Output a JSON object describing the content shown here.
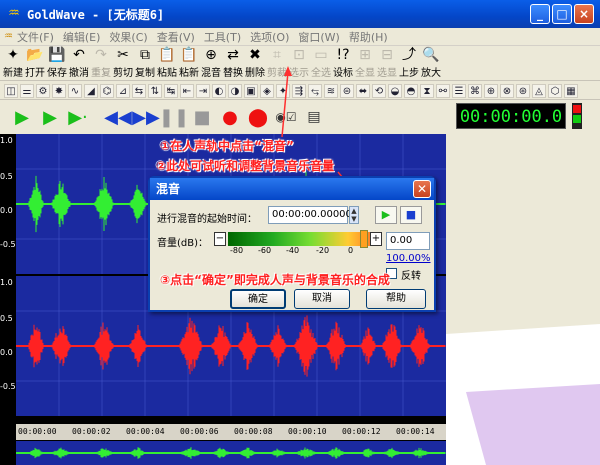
{
  "window": {
    "title": "GoldWave - [无标题6]",
    "controls": [
      "_",
      "□",
      "×"
    ]
  },
  "menu": [
    "文件(F)",
    "编辑(E)",
    "效果(C)",
    "查看(V)",
    "工具(T)",
    "选项(O)",
    "窗口(W)",
    "帮助(H)"
  ],
  "toolbar": [
    {
      "label": "新建",
      "icon": "✦",
      "enabled": true
    },
    {
      "label": "打开",
      "icon": "📂",
      "enabled": true
    },
    {
      "label": "保存",
      "icon": "💾",
      "enabled": true
    },
    {
      "label": "撤消",
      "icon": "↶",
      "enabled": true
    },
    {
      "label": "重复",
      "icon": "↷",
      "enabled": false
    },
    {
      "label": "剪切",
      "icon": "✂",
      "enabled": true
    },
    {
      "label": "复制",
      "icon": "⧉",
      "enabled": true
    },
    {
      "label": "粘贴",
      "icon": "📋",
      "enabled": true
    },
    {
      "label": "粘新",
      "icon": "📋",
      "enabled": true
    },
    {
      "label": "混音",
      "icon": "⊕",
      "enabled": true
    },
    {
      "label": "替换",
      "icon": "⇄",
      "enabled": true
    },
    {
      "label": "删除",
      "icon": "✖",
      "enabled": true
    },
    {
      "label": "剪裁",
      "icon": "⌗",
      "enabled": false
    },
    {
      "label": "选示",
      "icon": "⊡",
      "enabled": false
    },
    {
      "label": "全选",
      "icon": "▭",
      "enabled": false
    },
    {
      "label": "设标",
      "icon": "!?",
      "enabled": true
    },
    {
      "label": "全显",
      "icon": "⊞",
      "enabled": false
    },
    {
      "label": "选显",
      "icon": "⊟",
      "enabled": false
    },
    {
      "label": "上步",
      "icon": "⤴",
      "enabled": true
    },
    {
      "label": "放大",
      "icon": "🔍",
      "enabled": true
    }
  ],
  "transport": {
    "time": "00:00:00.0"
  },
  "waveform": {
    "channel_top_color": "#33ee33",
    "channel_bottom_color": "#ff2222",
    "background": "#1b2aa0",
    "scale_labels": [
      "1.0",
      "0.5",
      "0.0",
      "-0.5",
      "1.0",
      "0.5",
      "0.0",
      "-0.5"
    ]
  },
  "timeline": {
    "labels": [
      "00:00:00",
      "00:00:02",
      "00:00:04",
      "00:00:06",
      "00:00:08",
      "00:00:10",
      "00:00:12",
      "00:00:14"
    ]
  },
  "annotations": {
    "a1": "①在人声轨中点击“混音”",
    "a2": "②此处可试听和调整背景音乐音量",
    "a3": "③点击“确定”即完成人声与背景音乐的合成"
  },
  "dialog": {
    "title": "混音",
    "start_label": "进行混音的起始时间：",
    "start_value": "00:00:00.00000",
    "volume_label": "音量(dB)：",
    "volume_value": "0.00",
    "ticks": [
      "-80",
      "-60",
      "-40",
      "-20",
      "0"
    ],
    "percent": "100.00%",
    "invert_label": "反转",
    "ok": "确定",
    "cancel": "取消",
    "help": "帮助"
  }
}
